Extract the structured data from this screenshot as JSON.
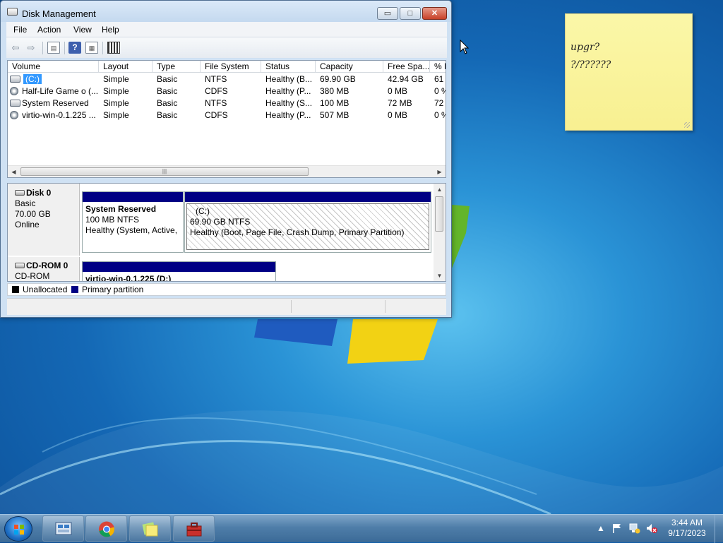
{
  "window": {
    "title": "Disk Management",
    "controls": {
      "minimize": "▭",
      "maximize": "□",
      "close": "✕"
    }
  },
  "menu": [
    "File",
    "Action",
    "View",
    "Help"
  ],
  "toolbar": [
    "back-icon",
    "forward-icon",
    "console-tree-icon",
    "help-icon",
    "properties-icon",
    "settings-icon"
  ],
  "volume_table": {
    "columns": [
      "Volume",
      "Layout",
      "Type",
      "File System",
      "Status",
      "Capacity",
      "Free Spa...",
      "% F"
    ],
    "rows": [
      {
        "volume": "(C:)",
        "layout": "Simple",
        "type": "Basic",
        "fs": "NTFS",
        "status": "Healthy (B...",
        "capacity": "69.90 GB",
        "free": "42.94 GB",
        "pct": "61",
        "icon": "disk",
        "selected": true
      },
      {
        "volume": "Half-Life Game o (...",
        "layout": "Simple",
        "type": "Basic",
        "fs": "CDFS",
        "status": "Healthy (P...",
        "capacity": "380 MB",
        "free": "0 MB",
        "pct": "0 %",
        "icon": "cd"
      },
      {
        "volume": "System Reserved",
        "layout": "Simple",
        "type": "Basic",
        "fs": "NTFS",
        "status": "Healthy (S...",
        "capacity": "100 MB",
        "free": "72 MB",
        "pct": "72",
        "icon": "disk"
      },
      {
        "volume": "virtio-win-0.1.225 ...",
        "layout": "Simple",
        "type": "Basic",
        "fs": "CDFS",
        "status": "Healthy (P...",
        "capacity": "507 MB",
        "free": "0 MB",
        "pct": "0 %",
        "icon": "cd"
      }
    ]
  },
  "disks": [
    {
      "name": "Disk 0",
      "kind": "Basic",
      "size": "70.00 GB",
      "state": "Online",
      "partitions": [
        {
          "name": "System Reserved",
          "fs": "100 MB NTFS",
          "status": "Healthy (System, Active,"
        },
        {
          "name": "(C:)",
          "fs": "69.90 GB NTFS",
          "status": "Healthy (Boot, Page File, Crash Dump, Primary Partition)"
        }
      ]
    },
    {
      "name": "CD-ROM 0",
      "kind": "CD-ROM",
      "partitions": [
        {
          "name": "virtio-win-0.1.225 (D:)"
        }
      ]
    }
  ],
  "legend": [
    {
      "label": "Unallocated",
      "color": "#000000"
    },
    {
      "label": "Primary partition",
      "color": "#000084"
    }
  ],
  "sticky_note": {
    "line1": "upgr?",
    "line2": "?/??????"
  },
  "taskbar": {
    "pinned": [
      "server-manager-icon",
      "chrome-icon",
      "sticky-notes-icon",
      "toolbox-icon"
    ],
    "clock_time": "3:44 AM",
    "clock_date": "9/17/2023",
    "tray_icons": [
      "show-hidden-icons",
      "action-center-flag-icon",
      "network-icon",
      "volume-muted-icon"
    ]
  },
  "colors": {
    "selection": "#3399ff",
    "partition_bar": "#000084",
    "sticky": "#f8f091"
  }
}
